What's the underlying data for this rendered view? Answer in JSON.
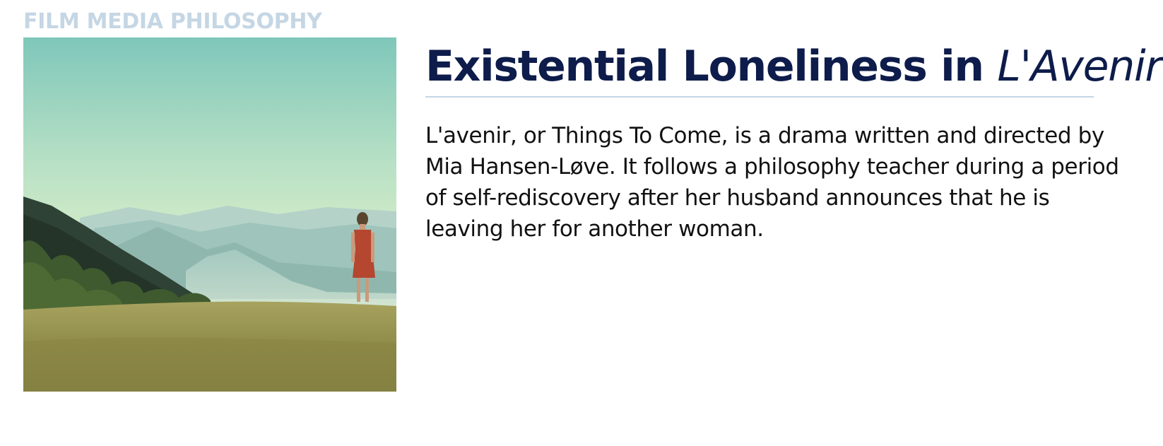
{
  "site": {
    "label": "FILM MEDIA PHILOSOPHY"
  },
  "article": {
    "title_main": "Existential Loneliness in ",
    "title_film": "L'Avenir",
    "body": "L'avenir, or Things To Come, is a drama written and directed by Mia Hansen-Løve. It follows a philosophy teacher during a period of self-rediscovery after her husband announces that he is leaving her for another woman."
  },
  "colors": {
    "site_label": "#c5d6e4",
    "title": "#0d1c4a",
    "rule": "#c5d6e4",
    "body_text": "#111111"
  }
}
